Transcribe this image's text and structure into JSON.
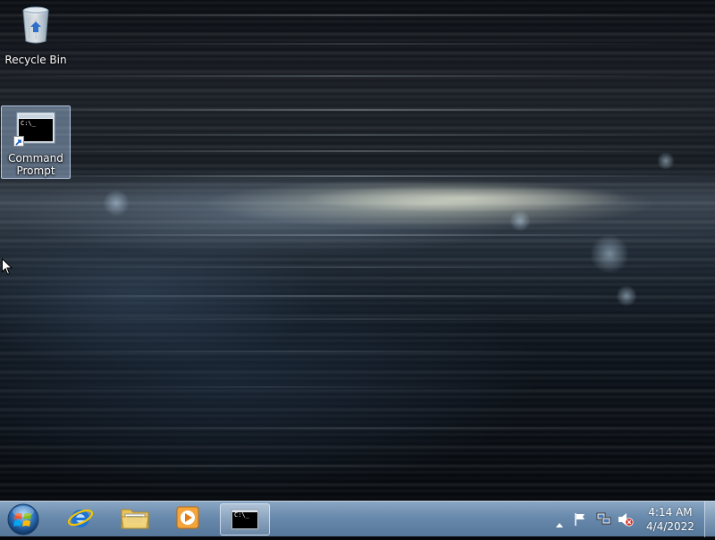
{
  "desktop": {
    "icons": [
      {
        "label": "Recycle Bin",
        "icon": "recycle-bin-icon",
        "selected": false
      },
      {
        "label_line1": "Command",
        "label_line2": "Prompt",
        "icon": "command-prompt-icon",
        "selected": true,
        "prompt_text": "C:\\_"
      }
    ]
  },
  "taskbar": {
    "start_button": {
      "icon": "windows-start-orb-icon"
    },
    "pinned": [
      {
        "name": "internet-explorer",
        "icon": "internet-explorer-icon"
      },
      {
        "name": "windows-explorer",
        "icon": "folder-library-icon"
      },
      {
        "name": "windows-media-player",
        "icon": "media-player-icon"
      },
      {
        "name": "command-prompt",
        "icon": "command-prompt-icon",
        "active": true,
        "prompt_text": "C:\\_"
      }
    ],
    "tray": {
      "icons": [
        "show-hidden-icons-arrow-icon",
        "action-center-flag-icon",
        "network-icon",
        "volume-muted-icon"
      ]
    },
    "clock": {
      "time": "4:14 AM",
      "date": "4/4/2022"
    }
  },
  "colors": {
    "taskbar": "#7e9fc2",
    "selection": "#aac8eb",
    "console_bg": "#000000"
  }
}
